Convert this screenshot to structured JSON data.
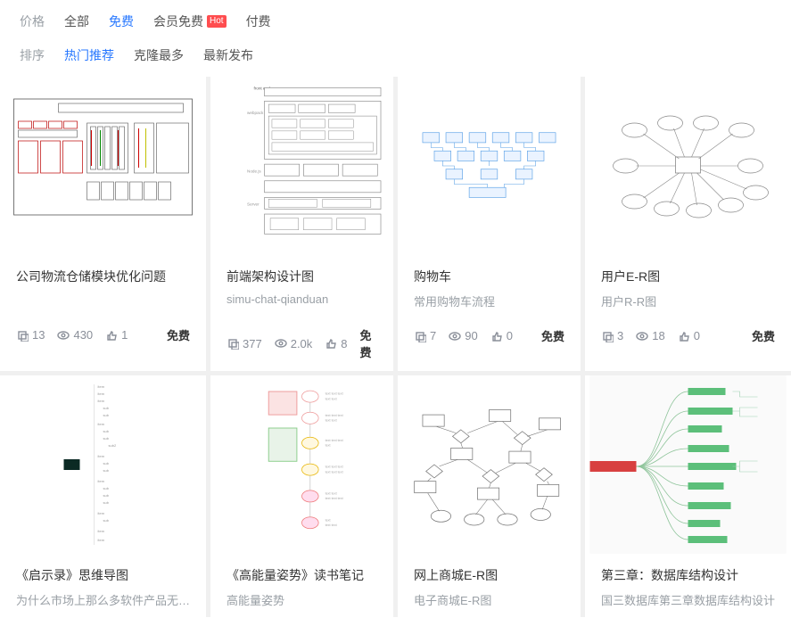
{
  "filters": {
    "price": {
      "label": "价格",
      "items": [
        "全部",
        "免费",
        "会员免费",
        "付费"
      ],
      "active": 1,
      "hotIndex": 2,
      "hotText": "Hot"
    },
    "sort": {
      "label": "排序",
      "items": [
        "热门推荐",
        "克隆最多",
        "最新发布"
      ],
      "active": 0
    }
  },
  "priceFree": "免费",
  "cards": [
    {
      "title": "公司物流仓储模块优化问题",
      "sub": "",
      "clones": "13",
      "views": "430",
      "likes": "1",
      "price": "免费"
    },
    {
      "title": "前端架构设计图",
      "sub": "simu-chat-qianduan",
      "clones": "377",
      "views": "2.0k",
      "likes": "8",
      "price": "免费"
    },
    {
      "title": "购物车",
      "sub": "常用购物车流程",
      "clones": "7",
      "views": "90",
      "likes": "0",
      "price": "免费"
    },
    {
      "title": "用户E-R图",
      "sub": "用户R-R图",
      "clones": "3",
      "views": "18",
      "likes": "0",
      "price": "免费"
    },
    {
      "title": "《启示录》思维导图",
      "sub": "为什么市场上那么多软件产品无…",
      "clones": "",
      "views": "",
      "likes": "",
      "price": ""
    },
    {
      "title": "《高能量姿势》读书笔记",
      "sub": "高能量姿势",
      "clones": "",
      "views": "",
      "likes": "",
      "price": ""
    },
    {
      "title": "网上商城E-R图",
      "sub": "电子商城E-R图",
      "clones": "",
      "views": "",
      "likes": "",
      "price": ""
    },
    {
      "title": "第三章：数据库结构设计",
      "sub": "国三数据库第三章数据库结构设计",
      "clones": "",
      "views": "",
      "likes": "",
      "price": ""
    }
  ]
}
